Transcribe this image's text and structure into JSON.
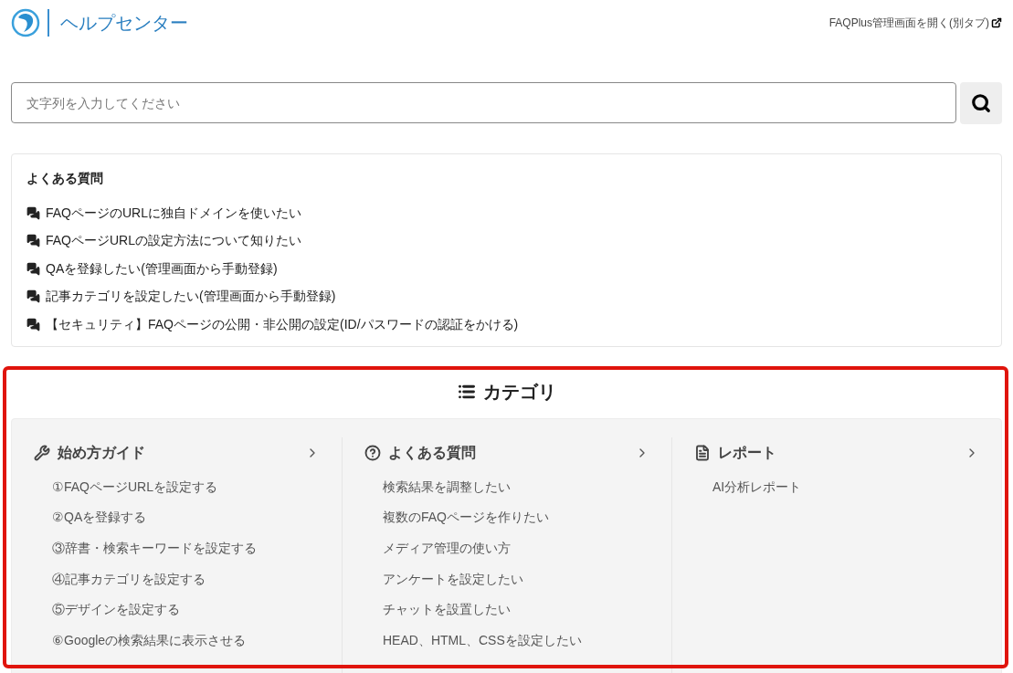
{
  "header": {
    "title": "ヘルプセンター",
    "admin_link": "FAQPlus管理画面を開く(別タブ)"
  },
  "search": {
    "placeholder": "文字列を入力してください"
  },
  "faq": {
    "title": "よくある質問",
    "items": [
      "FAQページのURLに独自ドメインを使いたい",
      "FAQページURLの設定方法について知りたい",
      "QAを登録したい(管理画面から手動登録)",
      "記事カテゴリを設定したい(管理画面から手動登録)",
      "【セキュリティ】FAQページの公開・非公開の設定(ID/パスワードの認証をかける)"
    ]
  },
  "categories": {
    "title": "カテゴリ",
    "columns": [
      {
        "kind": "tools",
        "title": "始め方ガイド",
        "items": [
          "①FAQページURLを設定する",
          "②QAを登録する",
          "③辞書・検索キーワードを設定する",
          "④記事カテゴリを設定する",
          "⑤デザインを設定する",
          "⑥Googleの検索結果に表示させる"
        ]
      },
      {
        "kind": "question",
        "title": "よくある質問",
        "items": [
          "検索結果を調整したい",
          "複数のFAQページを作りたい",
          "メディア管理の使い方",
          "アンケートを設定したい",
          "チャットを設置したい",
          "HEAD、HTML、CSSを設定したい"
        ]
      },
      {
        "kind": "document",
        "title": "レポート",
        "items": [
          "AI分析レポート"
        ]
      }
    ]
  }
}
